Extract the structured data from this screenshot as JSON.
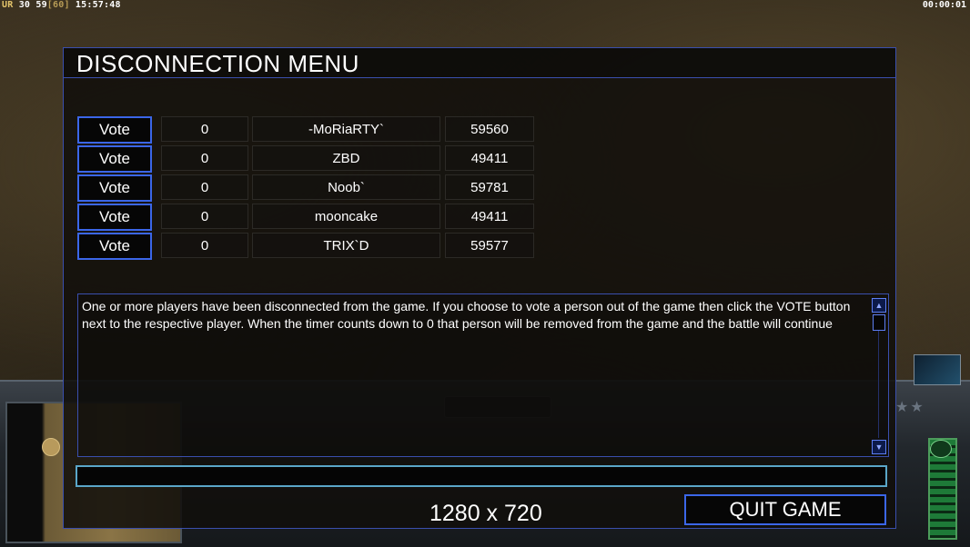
{
  "hud": {
    "ur_label": "UR",
    "fps": "30 59",
    "fps_max": "[60]",
    "clock": "15:57:48",
    "game_timer": "00:00:01"
  },
  "dialog": {
    "title": "DISCONNECTION MENU",
    "vote_label": "Vote",
    "players": [
      {
        "timer": "0",
        "name": "-MoRiaRTY`",
        "ping": "59560"
      },
      {
        "timer": "0",
        "name": "ZBD",
        "ping": "49411"
      },
      {
        "timer": "0",
        "name": "Noob`",
        "ping": "59781"
      },
      {
        "timer": "0",
        "name": "mooncake",
        "ping": "49411"
      },
      {
        "timer": "0",
        "name": "TRIX`D",
        "ping": "59577"
      }
    ],
    "message": "One or more players have been disconnected from the game. If you choose to vote a person out of the game then click the VOTE button next to the respective player. When the timer counts down to 0 that person will be removed from the game and the battle will continue",
    "chat_value": "",
    "quit_label": "QUIT GAME",
    "resolution": "1280 x 720"
  },
  "colors": {
    "accent_border": "#3b66e8",
    "chat_border": "#5aa6c8",
    "text": "#ffffff"
  }
}
